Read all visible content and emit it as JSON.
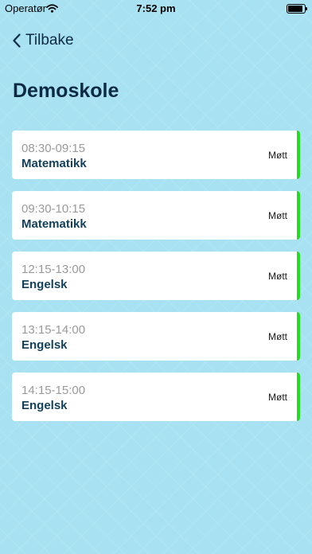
{
  "status_bar": {
    "carrier": "Operatør",
    "time": "7:52 pm"
  },
  "nav": {
    "back_label": "Tilbake"
  },
  "page": {
    "title": "Demoskole"
  },
  "colors": {
    "attendance_ok": "#22dd22",
    "background": "#a8e2f2"
  },
  "lessons": [
    {
      "time": "08:30-09:15",
      "subject": "Matematikk",
      "status": "Møtt"
    },
    {
      "time": "09:30-10:15",
      "subject": "Matematikk",
      "status": "Møtt"
    },
    {
      "time": "12:15-13:00",
      "subject": "Engelsk",
      "status": "Møtt"
    },
    {
      "time": "13:15-14:00",
      "subject": "Engelsk",
      "status": "Møtt"
    },
    {
      "time": "14:15-15:00",
      "subject": "Engelsk",
      "status": "Møtt"
    }
  ]
}
